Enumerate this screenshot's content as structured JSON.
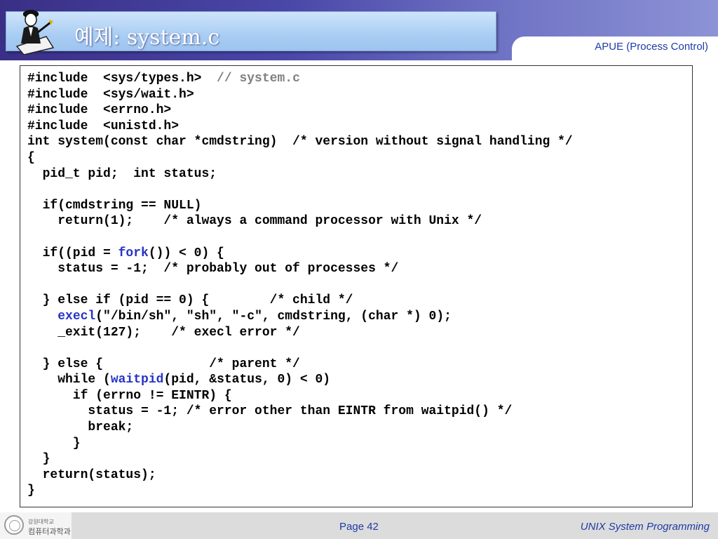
{
  "slide": {
    "title": "예제: system.c",
    "subtitle": "APUE (Process Control)",
    "page": "Page 42",
    "course": "UNIX System Programming",
    "university_small": "강원대학교",
    "university_main": "컴퓨터과학과"
  },
  "code": {
    "lines": [
      [
        {
          "t": "#include  <sys/types.h>  "
        },
        {
          "t": "// system.c",
          "s": "cmt"
        }
      ],
      [
        {
          "t": "#include  <sys/wait.h>"
        }
      ],
      [
        {
          "t": "#include  <errno.h>"
        }
      ],
      [
        {
          "t": "#include  <unistd.h>"
        }
      ],
      [
        {
          "t": "int system(const char *cmdstring)  /* version without signal handling */"
        }
      ],
      [
        {
          "t": "{"
        }
      ],
      [
        {
          "t": "  pid_t pid;  int status;"
        }
      ],
      [
        {
          "t": ""
        }
      ],
      [
        {
          "t": "  if(cmdstring == NULL)"
        }
      ],
      [
        {
          "t": "    return(1);    /* always a command processor with Unix */"
        }
      ],
      [
        {
          "t": ""
        }
      ],
      [
        {
          "t": "  if((pid = "
        },
        {
          "t": "fork",
          "s": "kw"
        },
        {
          "t": "()) < 0) {"
        }
      ],
      [
        {
          "t": "    status = -1;  /* probably out of processes */"
        }
      ],
      [
        {
          "t": ""
        }
      ],
      [
        {
          "t": "  } else if (pid == 0) {        /* child */"
        }
      ],
      [
        {
          "t": "    "
        },
        {
          "t": "execl",
          "s": "kw"
        },
        {
          "t": "(\"/bin/sh\", \"sh\", \"-c\", cmdstring, (char *) 0);"
        }
      ],
      [
        {
          "t": "    _exit(127);    /* execl error */"
        }
      ],
      [
        {
          "t": ""
        }
      ],
      [
        {
          "t": "  } else {              /* parent */"
        }
      ],
      [
        {
          "t": "    while ("
        },
        {
          "t": "waitpid",
          "s": "kw"
        },
        {
          "t": "(pid, &status, 0) < 0)"
        }
      ],
      [
        {
          "t": "      if (errno != EINTR) {"
        }
      ],
      [
        {
          "t": "        status = -1; /* error other than EINTR from waitpid() */"
        }
      ],
      [
        {
          "t": "        break;"
        }
      ],
      [
        {
          "t": "      }"
        }
      ],
      [
        {
          "t": "  }"
        }
      ],
      [
        {
          "t": "  return(status);"
        }
      ],
      [
        {
          "t": "}"
        }
      ]
    ]
  }
}
